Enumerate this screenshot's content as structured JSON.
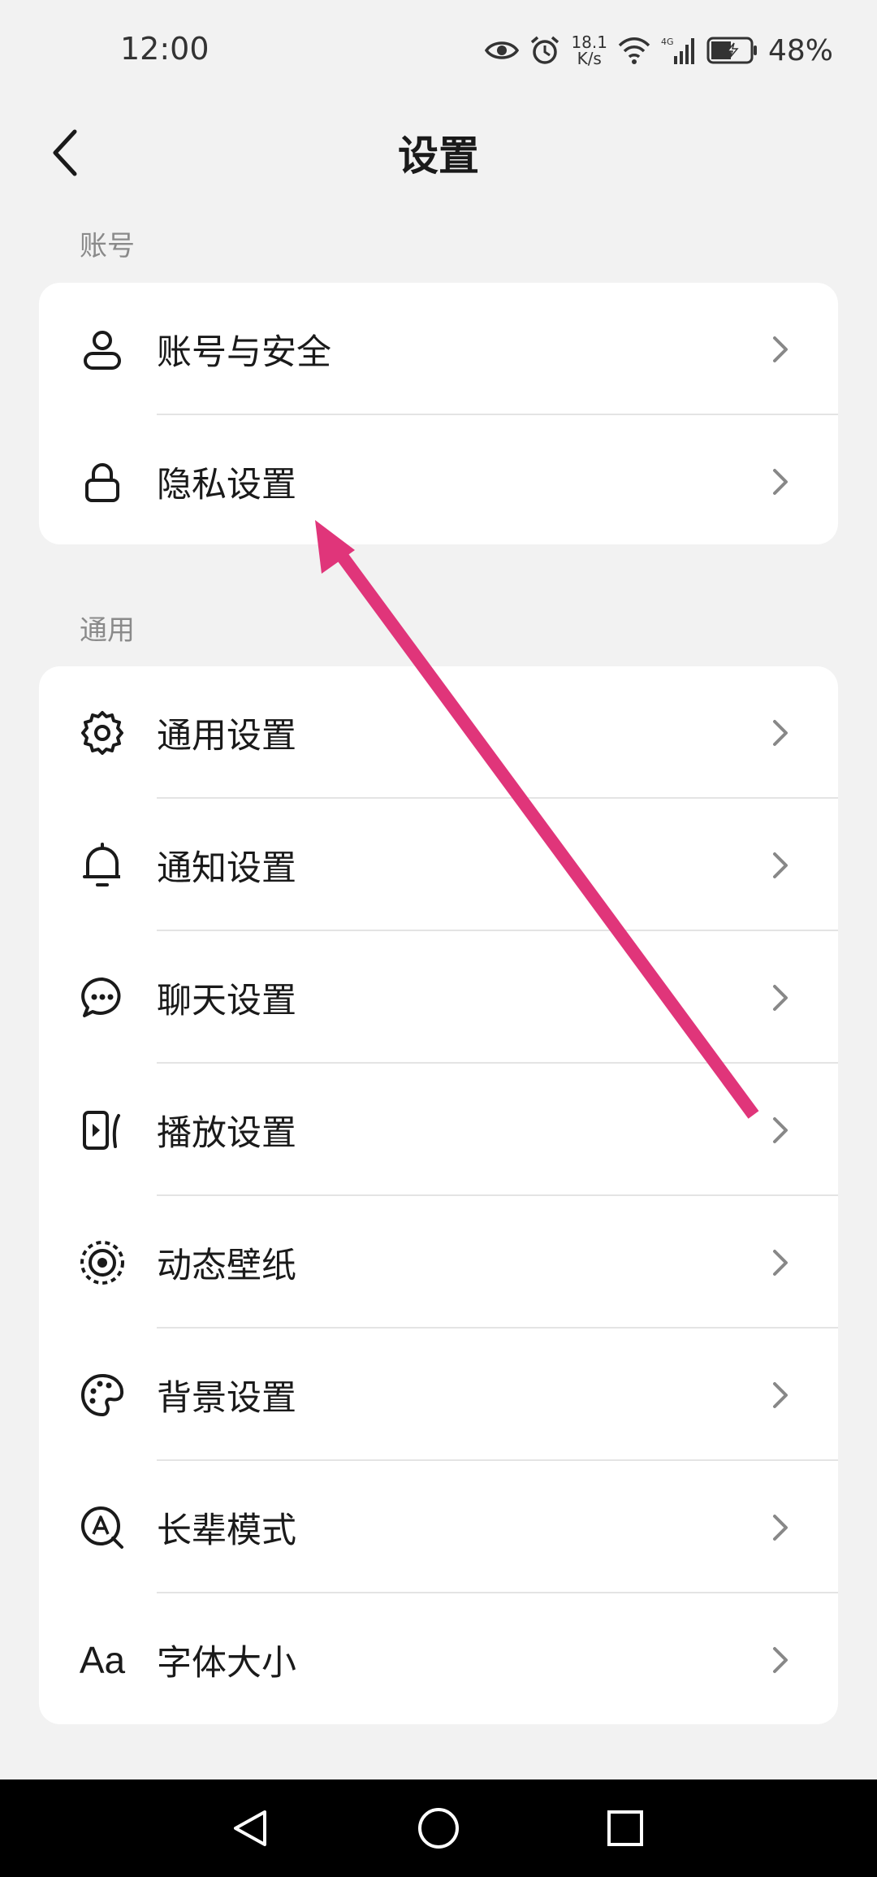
{
  "status_bar": {
    "time": "12:00",
    "net_speed_value": "18.1",
    "net_speed_unit": "K/s",
    "network_type": "4G",
    "battery": "48%"
  },
  "header": {
    "title": "设置",
    "back_icon": "chevron-left-icon"
  },
  "sections": [
    {
      "label": "账号",
      "items": [
        {
          "label": "账号与安全",
          "icon": "user-icon"
        },
        {
          "label": "隐私设置",
          "icon": "lock-icon"
        }
      ]
    },
    {
      "label": "通用",
      "items": [
        {
          "label": "通用设置",
          "icon": "gear-icon"
        },
        {
          "label": "通知设置",
          "icon": "bell-icon"
        },
        {
          "label": "聊天设置",
          "icon": "chat-bubble-icon"
        },
        {
          "label": "播放设置",
          "icon": "play-video-icon"
        },
        {
          "label": "动态壁纸",
          "icon": "dynamic-wallpaper-icon"
        },
        {
          "label": "背景设置",
          "icon": "palette-icon"
        },
        {
          "label": "长辈模式",
          "icon": "elder-mode-icon"
        },
        {
          "label": "字体大小",
          "icon": "font-size-icon",
          "icon_text": "Aa"
        }
      ]
    }
  ],
  "colors": {
    "background": "#f2f2f2",
    "card": "#ffffff",
    "annotation_arrow": "#e0357a",
    "navbar": "#000000"
  }
}
